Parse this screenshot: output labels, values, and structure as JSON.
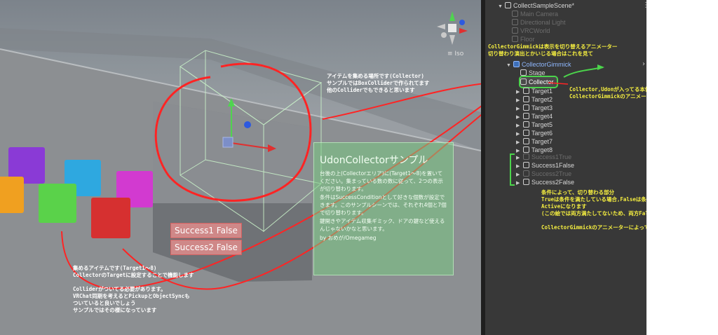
{
  "scene": {
    "iso_label": "≡ Iso",
    "status_texts": [
      "Success1 False",
      "Success2 False"
    ],
    "panel_title": "UdonCollectorサンプル",
    "panel_paragraphs": [
      "台後の上(Collectorエリア)に(Target1～8)を置いてください。集まっている数の数に従って、2つの表示が切り替わります。",
      "条件はSuccessConditionとして好きな個数が設定できます。このサンプルシーンでは、それぞれ4個と7個で切り替わります。",
      "鍵開きやアイテム収集ギミック、ドアの鍵など使えるんじゃないかなと思います。",
      "by おめが/Omegameg"
    ],
    "annotations": {
      "collector_note": "アイテムを集める場所です(Collector)\nサンプルではBoxColliderで作られてます\n他のColliderでもできると思います",
      "items_note": "集めるアイテムです(Target1～8)\nCollectorのTargetに設定することで機能します",
      "collider_note": "Colliderがついてる必要があります。\nVRChat同期を考えるとPickupとObjectSyncも\nついていると良いでしょう\nサンプルではその様になっています"
    }
  },
  "hierarchy": {
    "scene_name": "CollectSampleScene*",
    "items": [
      {
        "label": "Main Camera",
        "state": "dim"
      },
      {
        "label": "Directional Light",
        "state": "dim"
      },
      {
        "label": "VRCWorld",
        "state": "dim"
      },
      {
        "label": "Floor",
        "state": "dim"
      },
      {
        "label": "CollectorGimmick",
        "state": "blue"
      },
      {
        "label": "Stage",
        "state": "normal"
      },
      {
        "label": "Collector",
        "state": "highlight"
      },
      {
        "label": "Target1",
        "state": "normal"
      },
      {
        "label": "Target2",
        "state": "normal"
      },
      {
        "label": "Target3",
        "state": "normal"
      },
      {
        "label": "Target4",
        "state": "normal"
      },
      {
        "label": "Target5",
        "state": "normal"
      },
      {
        "label": "Target6",
        "state": "normal"
      },
      {
        "label": "Target7",
        "state": "normal"
      },
      {
        "label": "Target8",
        "state": "normal"
      },
      {
        "label": "Success1True",
        "state": "dim"
      },
      {
        "label": "Success1False",
        "state": "normal"
      },
      {
        "label": "Success2True",
        "state": "dim"
      },
      {
        "label": "Success2False",
        "state": "normal"
      }
    ],
    "annotations": {
      "gimmick_note": "CollectorGimmickは表示を切り替えるアニメーター\n切り替わり演出とかいじる場合はこれを見て",
      "collector_note": "Collector,Udonが入ってる本体\nCollectorGimmickのアニメーターを動かしている",
      "condition_note": "条件によって、切り替わる部分\nTrueは条件を満たしている場合,Falseは条件未達の時に\nActiveになります\n(この絵では両方満たしてないため、両方FalseがActiveです)\n\nCollectorGimmickのアニメーターによって駆動されます"
    }
  },
  "colors": {
    "annotation_yellow": "#f7f040",
    "annotation_red": "#ff3030",
    "highlight_green": "#4bd44b"
  }
}
